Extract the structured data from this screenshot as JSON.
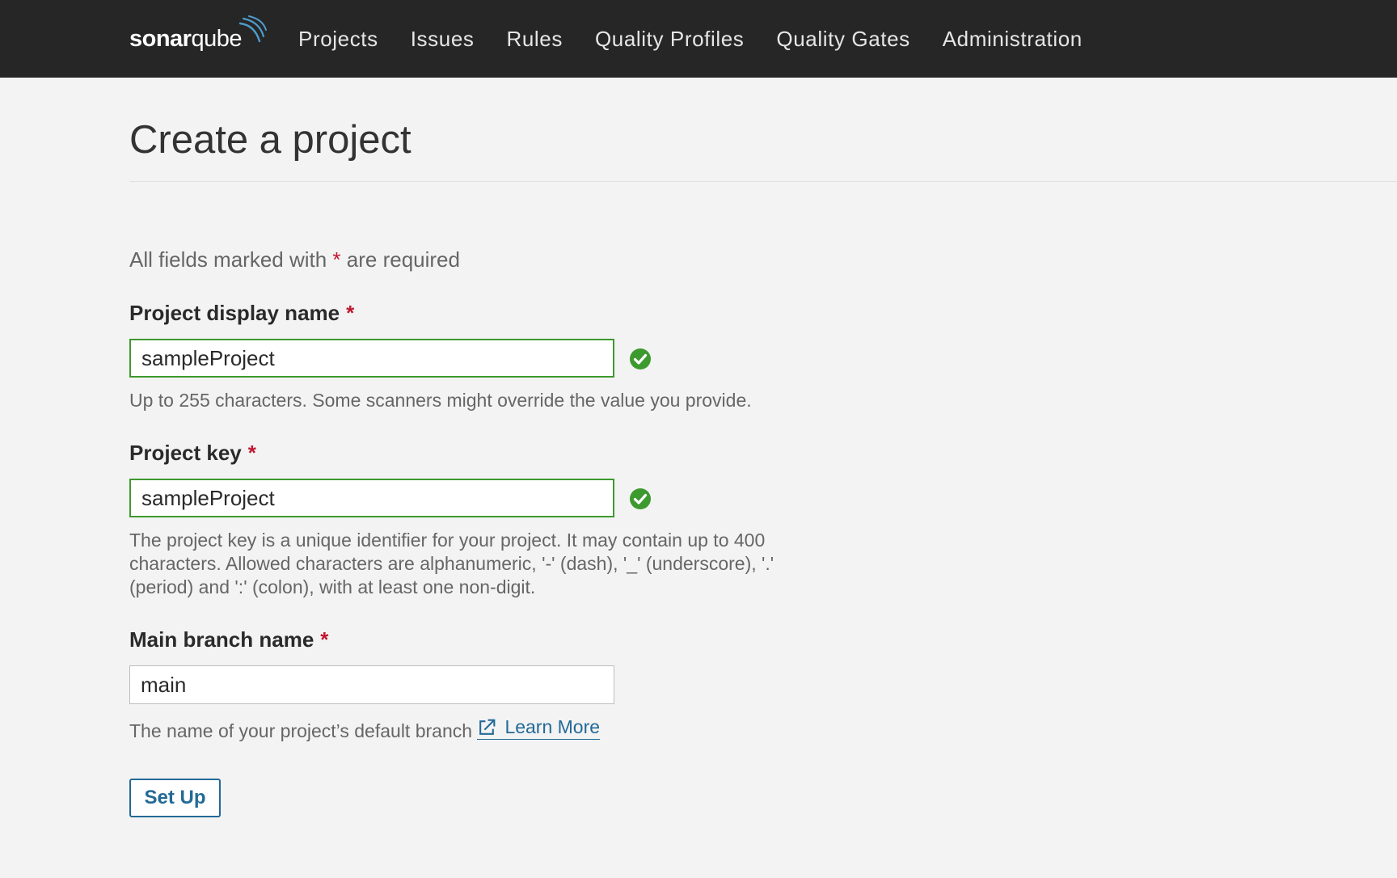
{
  "header": {
    "logo": {
      "bold": "sonar",
      "light": "qube"
    },
    "nav": [
      {
        "label": "Projects"
      },
      {
        "label": "Issues"
      },
      {
        "label": "Rules"
      },
      {
        "label": "Quality Profiles"
      },
      {
        "label": "Quality Gates"
      },
      {
        "label": "Administration"
      }
    ]
  },
  "page": {
    "title": "Create a project",
    "required_note_before": "All fields marked with ",
    "required_marker": "*",
    "required_note_after": " are required"
  },
  "form": {
    "display_name": {
      "label": "Project display name",
      "required_marker": "*",
      "value": "sampleProject",
      "valid": true,
      "help": "Up to 255 characters. Some scanners might override the value you provide."
    },
    "project_key": {
      "label": "Project key",
      "required_marker": "*",
      "value": "sampleProject",
      "valid": true,
      "help": "The project key is a unique identifier for your project. It may contain up to 400 characters. Allowed characters are alphanumeric, '-' (dash), '_' (underscore), '.' (period) and ':' (colon), with at least one non-digit."
    },
    "main_branch": {
      "label": "Main branch name",
      "required_marker": "*",
      "value": "main",
      "help_text": "The name of your project’s default branch ",
      "learn_more": "Learn More"
    },
    "submit_label": "Set Up"
  },
  "icons": {
    "valid": "check-circle-icon",
    "external_link": "external-link-icon"
  },
  "colors": {
    "header_bg": "#262626",
    "page_bg": "#f3f3f3",
    "valid_green": "#3d9a2e",
    "link_blue": "#236a97",
    "required_red": "#c0172f"
  }
}
